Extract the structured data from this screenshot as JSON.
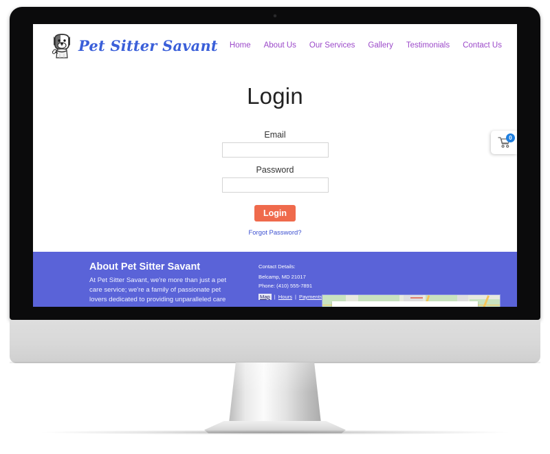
{
  "site": {
    "brand_name": "Pet Sitter Savant",
    "logo_icon": "dog-logo-icon",
    "brand_color": "#3a5fd9",
    "nav_color": "#9b48c9",
    "footer_color": "#5a63d8",
    "accent_button_color": "#ef6a4c"
  },
  "nav": {
    "items": [
      {
        "label": "Home"
      },
      {
        "label": "About Us"
      },
      {
        "label": "Our Services"
      },
      {
        "label": "Gallery"
      },
      {
        "label": "Testimonials"
      },
      {
        "label": "Contact Us"
      }
    ]
  },
  "login": {
    "title": "Login",
    "email_label": "Email",
    "email_value": "",
    "password_label": "Password",
    "password_value": "",
    "submit_label": "Login",
    "forgot_label": "Forgot Password?"
  },
  "cart": {
    "icon": "shopping-cart-icon",
    "count": "0",
    "badge_color": "#1f7fe0"
  },
  "footer": {
    "about_heading": "About Pet Sitter Savant",
    "about_text": "At Pet Sitter Savant, we're more than just a pet care service; we're a family of passionate pet lovers dedicated to providing unparalleled care and companionship for your furry friends. Based in Belcamp, MD, we offer a",
    "contact_heading": "Contact Details:",
    "contact_address": "Belcamp, MD 21017",
    "contact_phone": "Phone: (410) 555-7891",
    "links": [
      {
        "label": "Map",
        "active": true
      },
      {
        "label": "Hours",
        "active": false
      },
      {
        "label": "Payments Accepted",
        "active": false
      }
    ],
    "link_separator": "|",
    "map_label": "map-embed"
  }
}
